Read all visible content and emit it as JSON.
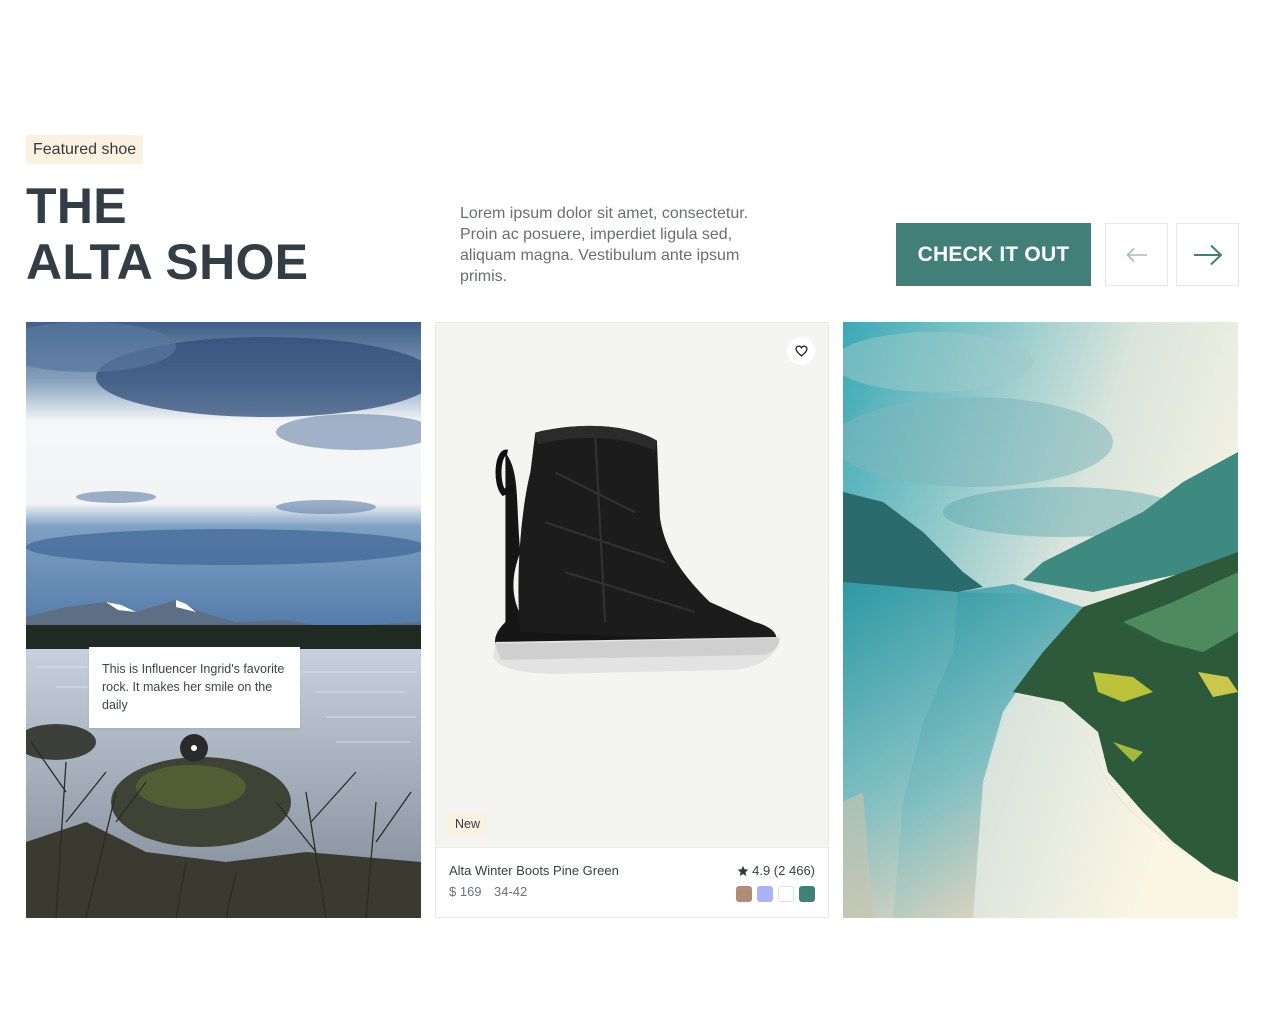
{
  "hero": {
    "eyebrow": "Featured shoe",
    "title_line1": "THE",
    "title_line2": "ALTA SHOE",
    "description": "Lorem ipsum dolor sit amet, consectetur. Proin ac posuere, imperdiet ligula sed, aliquam magna. Vestibulum ante ipsum primis.",
    "cta_label": "CHECK IT OUT",
    "prev_icon": "arrow-left-icon",
    "next_icon": "arrow-right-icon"
  },
  "influencer_card": {
    "tooltip_text": "This is Influencer Ingrid's favorite rock. It makes her smile on the daily"
  },
  "product_card": {
    "badge": "New",
    "name": "Alta Winter Boots Pine Green",
    "price": "$ 169",
    "sizes": "34-42",
    "rating": "4.9 (2 466)",
    "favorite_icon": "heart-icon",
    "swatches": [
      "#b08d76",
      "#aab3f6",
      "#ffffff",
      "#427f79"
    ]
  },
  "colors": {
    "accent": "#427f79",
    "badge_bg": "#fbf1e1",
    "heading": "#323d45"
  }
}
